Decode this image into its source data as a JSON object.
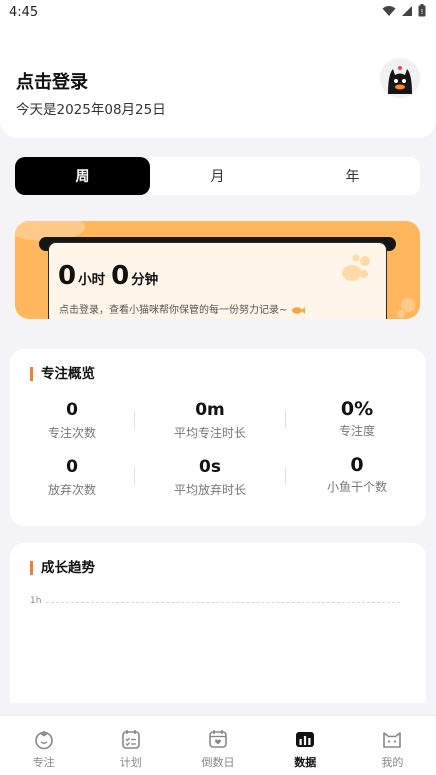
{
  "status_bar": {
    "time": "4:45",
    "icons": [
      "wifi-icon",
      "signal-icon",
      "battery-icon"
    ]
  },
  "header": {
    "login_title": "点击登录",
    "today_text": "今天是2025年08月25日"
  },
  "period_tabs": [
    {
      "label": "周",
      "active": true
    },
    {
      "label": "月",
      "active": false
    },
    {
      "label": "年",
      "active": false
    }
  ],
  "focus_banner": {
    "hours_value": "0",
    "hours_unit": "小时",
    "minutes_value": "0",
    "minutes_unit": "分钟",
    "subtitle": "点击登录，查看小猫咪帮你保管的每一份努力记录~"
  },
  "overview": {
    "title": "专注概览",
    "stats": [
      {
        "value": "0",
        "label": "专注次数"
      },
      {
        "value": "0m",
        "label": "平均专注时长"
      },
      {
        "value": "0%",
        "label": "专注度"
      },
      {
        "value": "0",
        "label": "放弃次数"
      },
      {
        "value": "0s",
        "label": "平均放弃时长"
      },
      {
        "value": "0",
        "label": "小鱼干个数"
      }
    ]
  },
  "growth": {
    "title": "成长趋势",
    "y_tick": "1h"
  },
  "bottom_nav": [
    {
      "label": "专注",
      "icon": "tomato-icon",
      "active": false
    },
    {
      "label": "计划",
      "icon": "calendar-checklist-icon",
      "active": false
    },
    {
      "label": "倒数日",
      "icon": "calendar-heart-icon",
      "active": false
    },
    {
      "label": "数据",
      "icon": "bar-chart-icon",
      "active": true
    },
    {
      "label": "我的",
      "icon": "cat-face-icon",
      "active": false
    }
  ],
  "colors": {
    "accent": "#ff7a2e",
    "banner": "#ffb65c",
    "active_tab": "#000000"
  }
}
